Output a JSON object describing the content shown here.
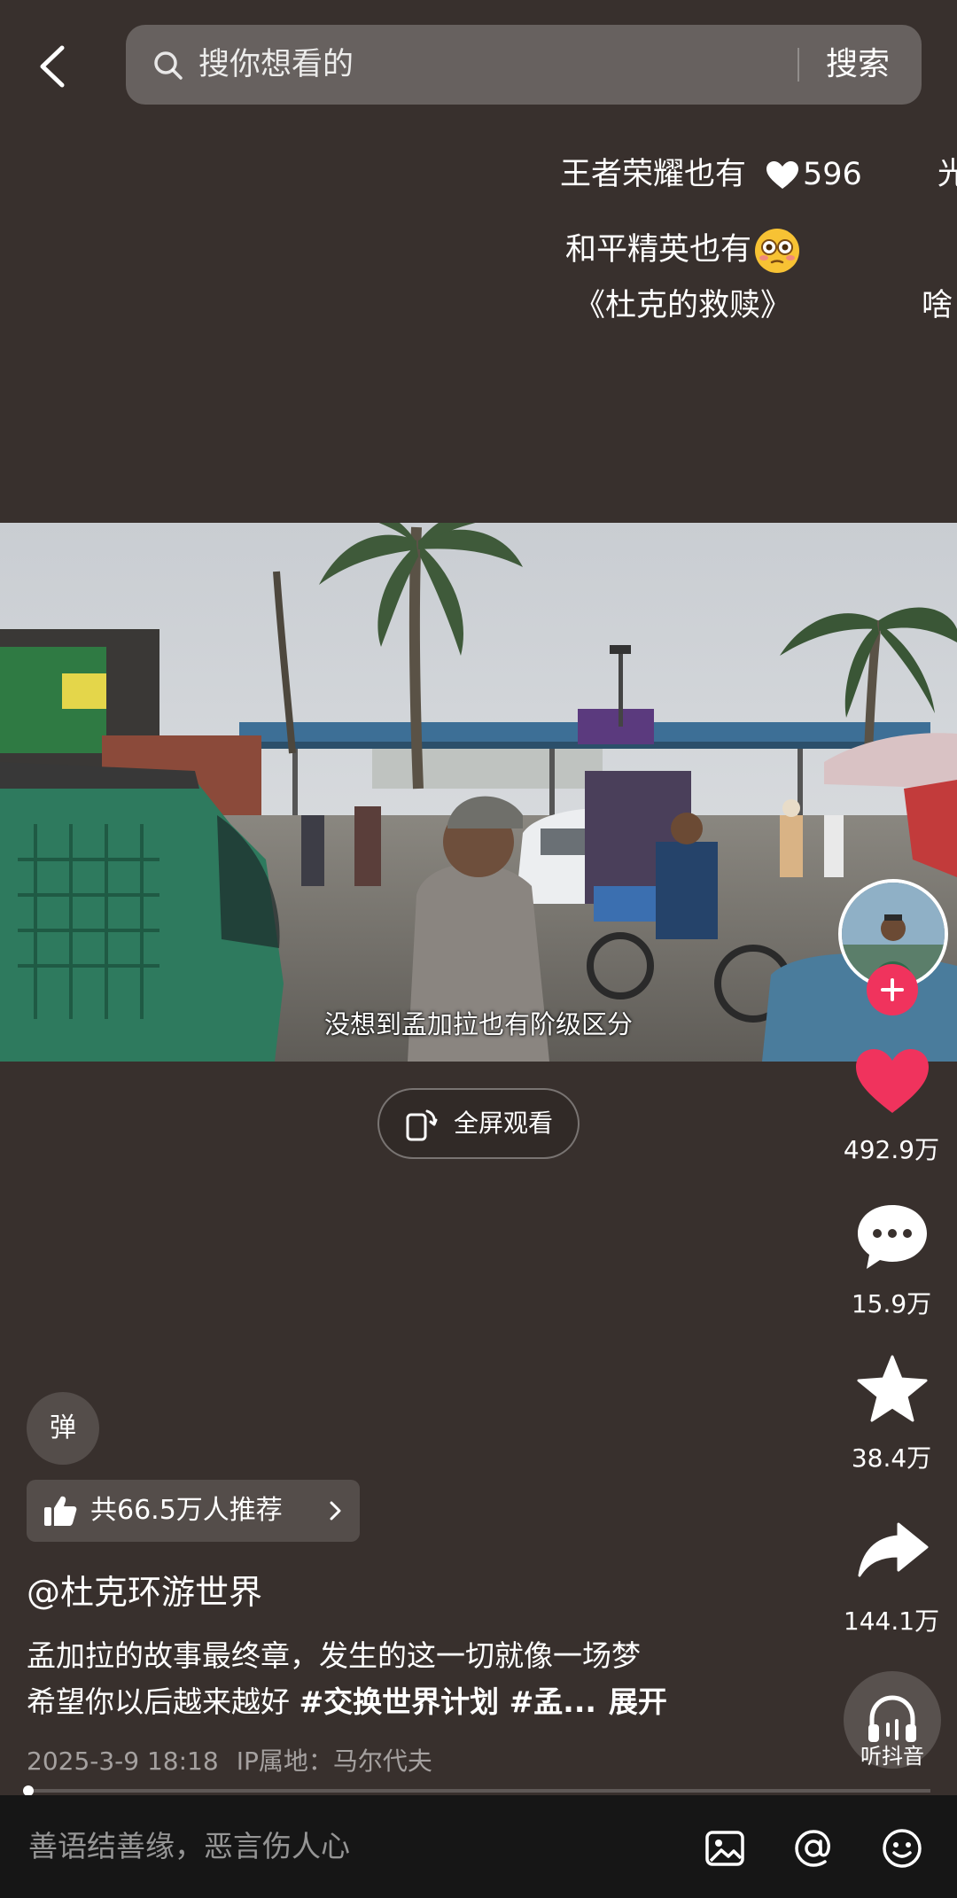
{
  "search": {
    "placeholder": "搜你想看的",
    "button": "搜索"
  },
  "danmaku": [
    {
      "text": "王者荣耀也有",
      "likes": "596"
    },
    {
      "text": "光",
      "partial": true
    },
    {
      "text": "和平精英也有",
      "emoji": "flushed-face"
    },
    {
      "text": "《杜克的救赎》"
    },
    {
      "text": "啥",
      "partial": true
    }
  ],
  "video": {
    "subtitle": "没想到孟加拉也有阶级区分",
    "fullscreen_label": "全屏观看"
  },
  "rail": {
    "likes": "492.9万",
    "comments": "15.9万",
    "favorites": "38.4万",
    "shares": "144.1万",
    "listen_label": "听抖音"
  },
  "info": {
    "danmu_toggle": "弹",
    "recommend": "共66.5万人推荐",
    "author": "@杜克环游世界",
    "desc_line1": "孟加拉的故事最终章，发生的这一切就像一场梦",
    "desc_line2_text": "希望你以后越来越好 ",
    "desc_line2_tags": "#交换世界计划 #孟...",
    "expand": "展开",
    "date": "2025-3-9 18:18",
    "ip": "IP属地：马尔代夫",
    "progress": 0.0
  },
  "comment_bar": {
    "placeholder": "善语结善缘，恶言伤人心"
  },
  "icons": [
    "back-chevron-icon",
    "search-icon",
    "heart-icon",
    "comment-icon",
    "star-icon",
    "share-icon",
    "headphones-icon",
    "thumbs-up-icon",
    "image-icon",
    "at-icon",
    "emoji-icon",
    "fullscreen-phone-icon"
  ],
  "colors": {
    "background": "#38302d",
    "like_red": "#f0335d",
    "comment_bar": "#161616"
  }
}
